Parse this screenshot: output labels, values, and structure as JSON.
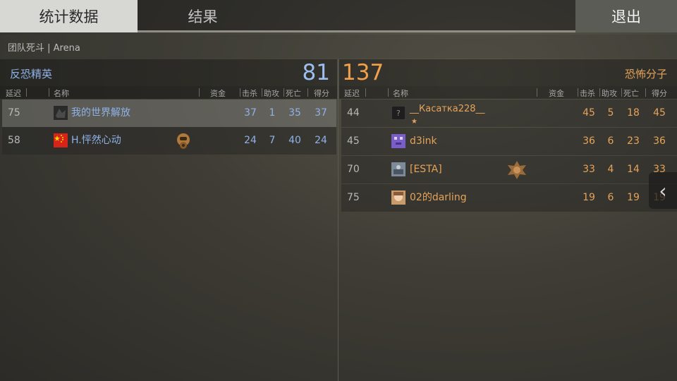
{
  "tabs": {
    "stats": "统计数据",
    "results": "结果",
    "exit": "退出"
  },
  "mode_text": "团队死斗 | Arena",
  "ct": {
    "team_name": "反恐精英",
    "score": "81",
    "headers": {
      "ping": "延迟",
      "name": "名称",
      "money": "资金",
      "kills": "击杀",
      "assists": "助攻",
      "deaths": "死亡",
      "score": "得分"
    },
    "players": [
      {
        "ping": "75",
        "name": "我的世界解放",
        "kills": "37",
        "assists": "1",
        "deaths": "35",
        "score": "37",
        "avatar_icon": "dark-avatar-icon"
      },
      {
        "ping": "58",
        "name": "H.怦然心动",
        "kills": "24",
        "assists": "7",
        "deaths": "40",
        "score": "24",
        "avatar_icon": "china-flag-icon",
        "badge_icon": "gas-mask-medal-icon"
      }
    ]
  },
  "t": {
    "team_name": "恐怖分子",
    "score": "137",
    "headers": {
      "ping": "延迟",
      "name": "名称",
      "money": "资金",
      "kills": "击杀",
      "assists": "助攻",
      "deaths": "死亡",
      "score": "得分"
    },
    "players": [
      {
        "ping": "44",
        "name": "__Касатка228__",
        "name_mark": "★",
        "kills": "45",
        "assists": "5",
        "deaths": "18",
        "score": "45",
        "avatar_icon": "unknown-avatar-icon"
      },
      {
        "ping": "45",
        "name": "d3ink",
        "kills": "36",
        "assists": "6",
        "deaths": "23",
        "score": "36",
        "avatar_icon": "pixel-avatar-icon"
      },
      {
        "ping": "70",
        "name": "[ESTA]",
        "kills": "33",
        "assists": "4",
        "deaths": "14",
        "score": "33",
        "avatar_icon": "photo-avatar-icon",
        "badge_icon": "service-medal-icon"
      },
      {
        "ping": "75",
        "name": "02的darling",
        "kills": "19",
        "assists": "6",
        "deaths": "19",
        "score": "19",
        "avatar_icon": "anime-avatar-icon"
      }
    ]
  },
  "side_arrow_icon": "chevron-left-icon",
  "colors": {
    "ct": "#8fb2e6",
    "t": "#e6a35a",
    "active_tab": "#d7d7d3"
  }
}
